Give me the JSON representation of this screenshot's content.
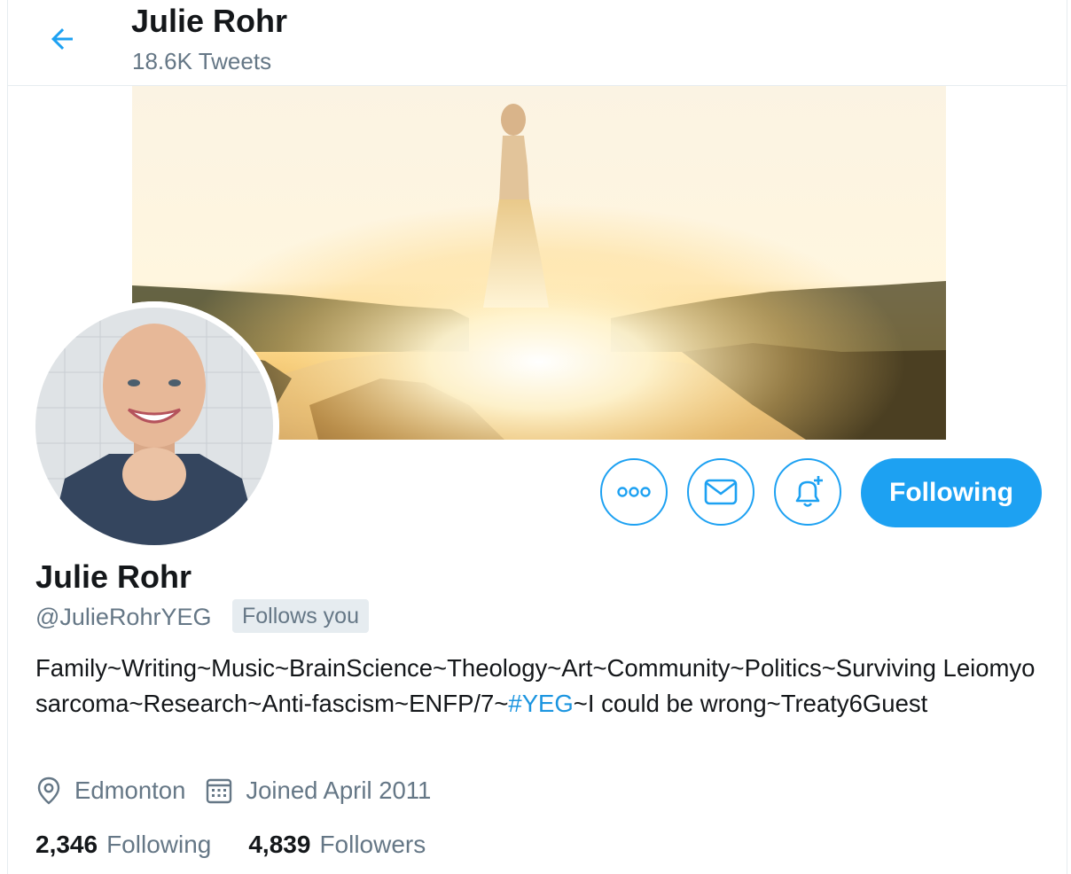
{
  "header": {
    "back_icon": "arrow-left-icon",
    "name": "Julie Rohr",
    "tweet_count": "18.6K Tweets"
  },
  "profile": {
    "display_name": "Julie Rohr",
    "handle": "@JulieRohrYEG",
    "follows_you": "Follows you",
    "bio_parts": {
      "before": "Family~Writing~Music~BrainScience~Theology~Art~Community~Politics~Surviving Leiomyosarcoma~Research~Anti-fascism~ENFP/7~",
      "hashtag": "#YEG",
      "after": "~I could be wrong~Treaty6Guest"
    },
    "location": "Edmonton",
    "joined": "Joined April 2011",
    "following_count": "2,346",
    "following_label": "Following",
    "followers_count": "4,839",
    "followers_label": "Followers"
  },
  "actions": {
    "more_icon": "more-icon",
    "message_icon": "envelope-icon",
    "notify_icon": "bell-plus-icon",
    "follow_label": "Following"
  },
  "colors": {
    "accent": "#1da1f2",
    "text_primary": "#14171a",
    "text_secondary": "#657786",
    "badge_bg": "#e6ecf0"
  }
}
